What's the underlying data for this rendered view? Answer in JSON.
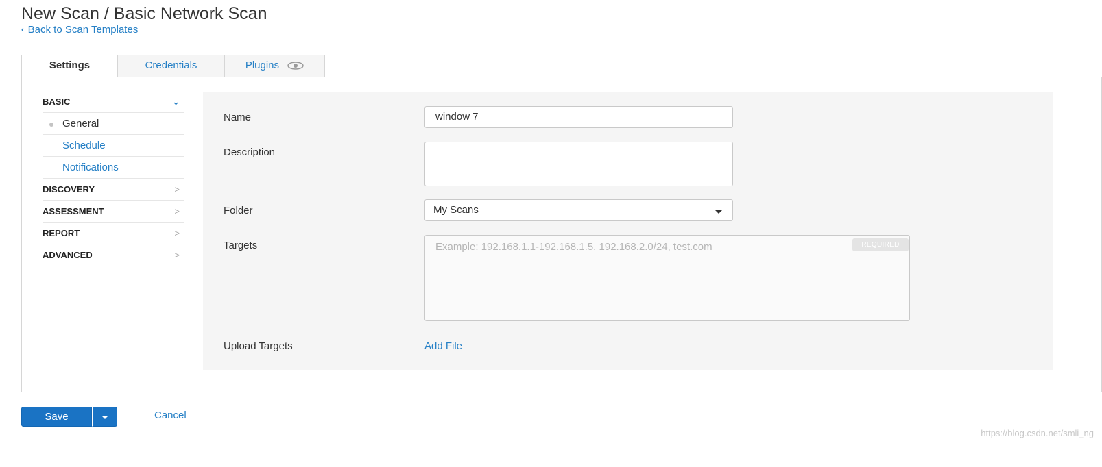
{
  "header": {
    "title": "New Scan / Basic Network Scan",
    "back_link": "Back to Scan Templates"
  },
  "tabs": [
    {
      "label": "Settings",
      "active": true
    },
    {
      "label": "Credentials",
      "active": false
    },
    {
      "label": "Plugins",
      "active": false,
      "icon": "eye-icon"
    }
  ],
  "sidebar": {
    "sections": [
      {
        "label": "BASIC",
        "expanded": true,
        "items": [
          "General",
          "Schedule",
          "Notifications"
        ],
        "current": "General"
      },
      {
        "label": "DISCOVERY",
        "expanded": false
      },
      {
        "label": "ASSESSMENT",
        "expanded": false
      },
      {
        "label": "REPORT",
        "expanded": false
      },
      {
        "label": "ADVANCED",
        "expanded": false
      }
    ]
  },
  "form": {
    "name_label": "Name",
    "name_value": "window 7",
    "description_label": "Description",
    "description_value": "",
    "folder_label": "Folder",
    "folder_value": "My Scans",
    "targets_label": "Targets",
    "targets_placeholder": "Example: 192.168.1.1-192.168.1.5, 192.168.2.0/24, test.com",
    "targets_required": "REQUIRED",
    "upload_label": "Upload Targets",
    "add_file": "Add File"
  },
  "actions": {
    "save": "Save",
    "cancel": "Cancel"
  },
  "watermark": "https://blog.csdn.net/smli_ng",
  "colors": {
    "accent": "#2680c6",
    "primary_button": "#1a73c4",
    "form_bg": "#f5f5f5"
  }
}
